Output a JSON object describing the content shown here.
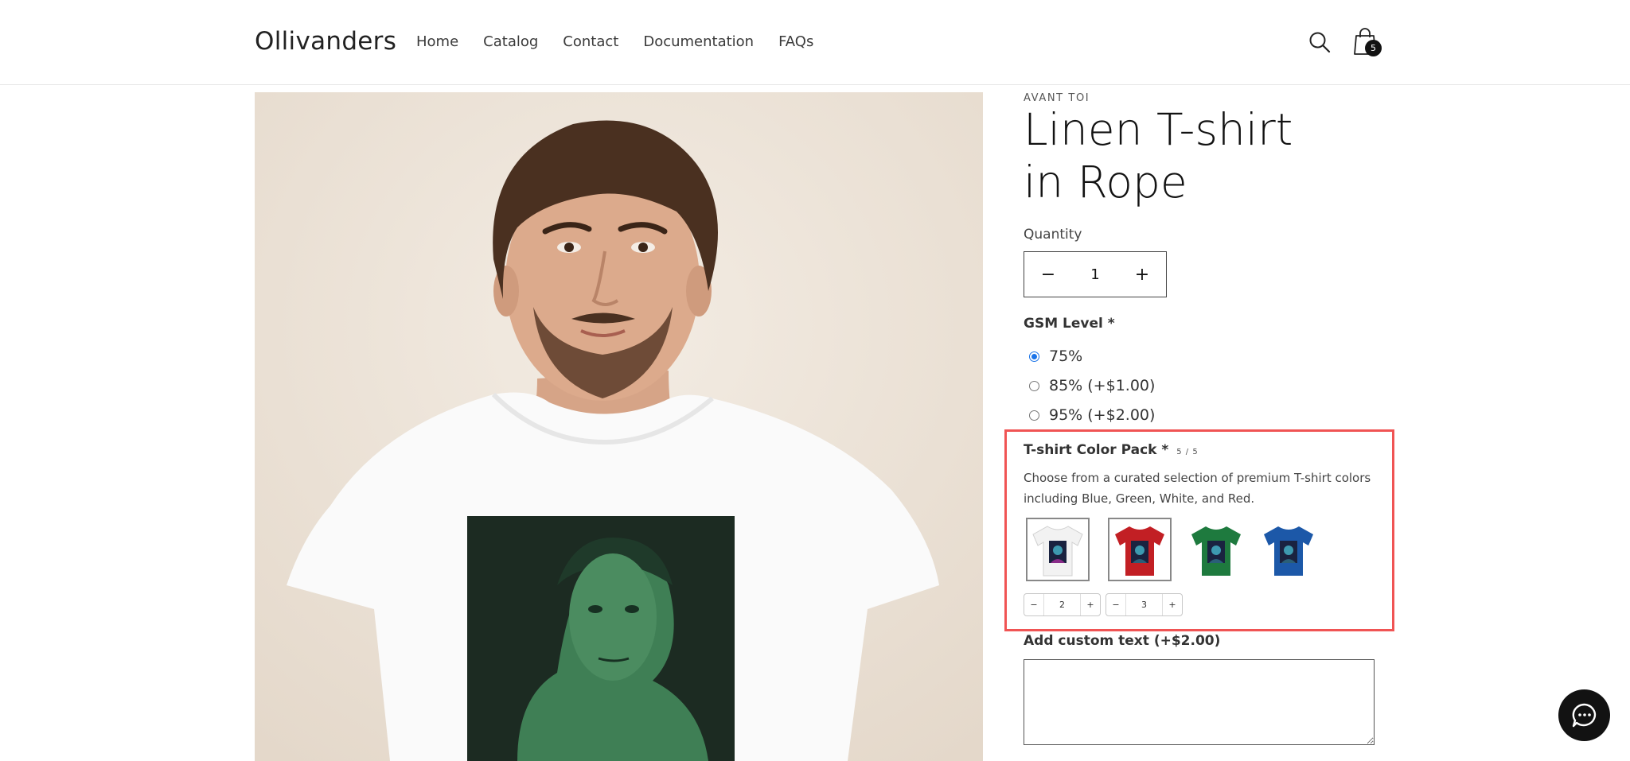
{
  "header": {
    "logo": "Ollivanders",
    "nav": [
      "Home",
      "Catalog",
      "Contact",
      "Documentation",
      "FAQs"
    ],
    "cart_count": "5"
  },
  "product": {
    "vendor": "AVANT TOI",
    "title": "Linen T-shirt in Rope",
    "quantity_label": "Quantity",
    "quantity_value": "1",
    "quantity_decrease": "−",
    "quantity_increase": "+"
  },
  "gsm": {
    "label": "GSM Level *",
    "options": [
      {
        "label": "75%",
        "selected": true
      },
      {
        "label": "85% (+$1.00)",
        "selected": false
      },
      {
        "label": "95% (+$2.00)",
        "selected": false
      }
    ]
  },
  "color_pack": {
    "title": "T-shirt Color Pack *",
    "count": "5 / 5",
    "description": "Choose from a curated selection of premium T-shirt colors including Blue, Green, White, and Red.",
    "swatches": [
      {
        "color": "white",
        "shirt_hex": "#f2f2f2",
        "selected": true
      },
      {
        "color": "red",
        "shirt_hex": "#c21f24",
        "selected": true
      },
      {
        "color": "green",
        "shirt_hex": "#1e7a3e",
        "selected": false
      },
      {
        "color": "blue",
        "shirt_hex": "#1c58a8",
        "selected": false
      }
    ],
    "steppers": [
      {
        "minus": "−",
        "value": "2",
        "plus": "+"
      },
      {
        "minus": "−",
        "value": "3",
        "plus": "+"
      }
    ]
  },
  "custom_text": {
    "label": "Add custom text (+$2.00)",
    "value": ""
  },
  "colors": {
    "highlight": "#f05454",
    "radio_accent": "#1a73e8"
  }
}
